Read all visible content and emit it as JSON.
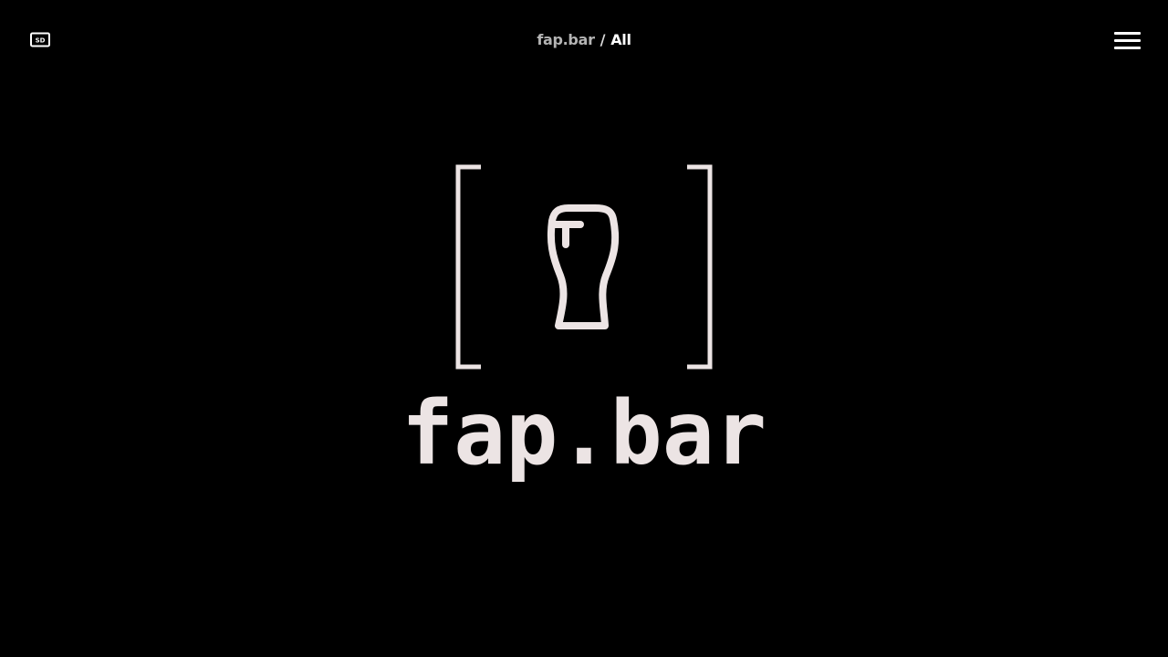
{
  "header": {
    "quality_toggle_icon": "sd-video-icon",
    "breadcrumb": {
      "root": "fap.bar",
      "separator": "/",
      "current": "All"
    },
    "menu_icon": "hamburger-menu-icon"
  },
  "hero": {
    "logo_icon": "beer-glass-icon",
    "wordmark": "fap.bar"
  },
  "colors": {
    "background": "#000000",
    "logo": "#ece4e4",
    "breadcrumb_root": "#b4b4b4",
    "breadcrumb_current": "#ffffff"
  }
}
